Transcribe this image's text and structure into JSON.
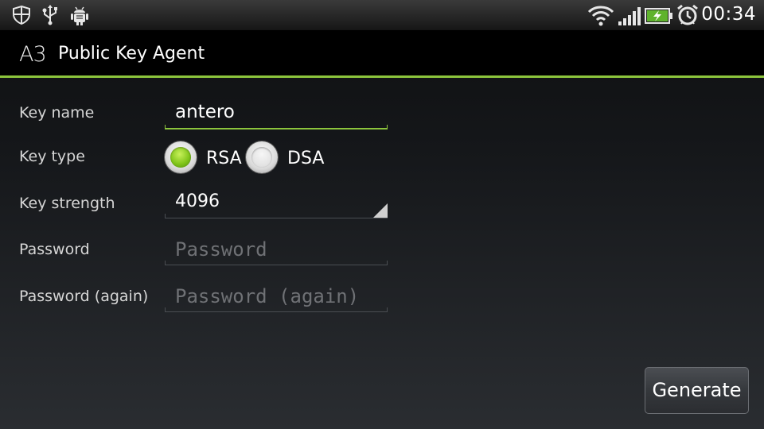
{
  "status_bar": {
    "time": "00:34",
    "left_icons": [
      "shield-icon",
      "usb-icon",
      "android-debug-icon"
    ],
    "right_icons": [
      "wifi-icon",
      "signal-icon",
      "battery-charging-icon",
      "alarm-icon"
    ]
  },
  "app": {
    "icon_text": "A3",
    "title": "Public Key Agent",
    "accent_color": "#8cc43c"
  },
  "form": {
    "key_name": {
      "label": "Key name",
      "value": "antero"
    },
    "key_type": {
      "label": "Key type",
      "options": [
        {
          "label": "RSA",
          "checked": true
        },
        {
          "label": "DSA",
          "checked": false
        }
      ]
    },
    "key_strength": {
      "label": "Key strength",
      "value": "4096"
    },
    "password": {
      "label": "Password",
      "placeholder": "Password"
    },
    "password_again": {
      "label": "Password (again)",
      "placeholder": "Password (again)"
    }
  },
  "actions": {
    "generate_label": "Generate"
  }
}
